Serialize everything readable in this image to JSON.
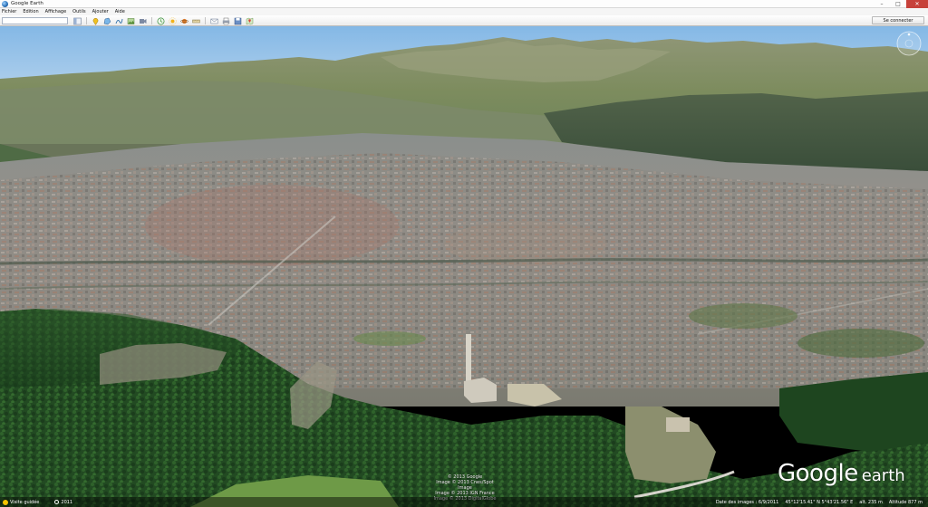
{
  "window": {
    "title": "Google Earth",
    "minimize": "–",
    "maximize": "□",
    "close": "✕"
  },
  "menu": [
    "Fichier",
    "Edition",
    "Affichage",
    "Outils",
    "Ajouter",
    "Aide"
  ],
  "toolbar": {
    "search_value": "",
    "tools": [
      "sidebar-toggle-icon",
      "placemark-icon",
      "polygon-icon",
      "path-icon",
      "image-overlay-icon",
      "record-tour-icon",
      "historical-imagery-icon",
      "sunlight-icon",
      "planets-icon",
      "ruler-icon",
      "email-icon",
      "print-icon",
      "save-image-icon",
      "maps-icon"
    ],
    "signin_label": "Se connecter"
  },
  "viewport": {
    "imagery_credits": [
      "© 2013 Google",
      "Image © 2013 Cnes/Spot Image",
      "Image © 2013 IGN France",
      "Image © 2013 DigitalGlobe"
    ],
    "logo_google": "Google",
    "logo_earth": "earth"
  },
  "statusbar": {
    "street_view_label": "Visite guidée",
    "imagery_year": "2011",
    "date_label": "Date des images : 6/9/2011",
    "coords_label": "45°12'15.41\" N  5°43'21.56\" E",
    "elevation_label": "alt. 235 m",
    "eye_alt_label": "Altitude 877 m"
  },
  "colors": {
    "sky_top": "#8fc0ea",
    "sky_horizon": "#c9def0",
    "forest": "#1f4a22",
    "city": "#8e8a86",
    "close_button": "#c7413a",
    "street_view": "#f5c400"
  }
}
